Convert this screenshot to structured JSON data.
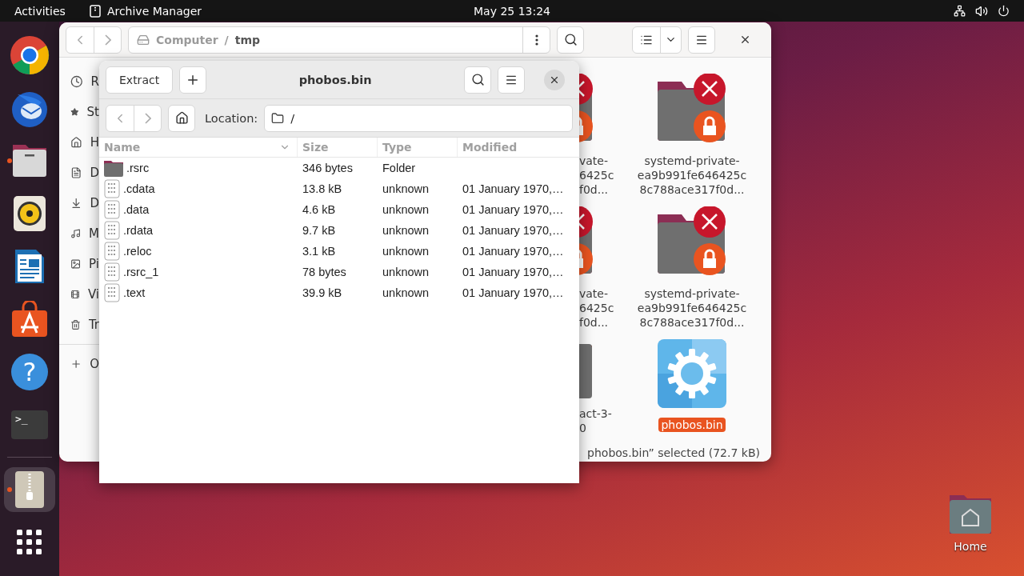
{
  "top_bar": {
    "activities": "Activities",
    "app_name": "Archive Manager",
    "clock": "May 25  13:24"
  },
  "dock": {
    "items": [
      {
        "kind": "chrome",
        "running": false,
        "selected": false
      },
      {
        "kind": "thunderbird",
        "running": false,
        "selected": false
      },
      {
        "kind": "files",
        "running": true,
        "selected": false
      },
      {
        "kind": "rhythmbox",
        "running": false,
        "selected": false
      },
      {
        "kind": "writer",
        "running": false,
        "selected": false
      },
      {
        "kind": "appstore",
        "running": false,
        "selected": false
      },
      {
        "kind": "help",
        "glyph": "?",
        "running": false,
        "selected": false
      },
      {
        "kind": "terminal",
        "glyph": ">_",
        "running": false,
        "selected": false
      },
      {
        "kind": "archive",
        "running": true,
        "selected": true
      },
      {
        "kind": "apps",
        "running": false,
        "selected": false
      }
    ]
  },
  "files_window": {
    "path": [
      "Computer",
      "tmp"
    ],
    "path_separator": "/",
    "sidebar": [
      {
        "kind": "recent",
        "label": "R"
      },
      {
        "kind": "starred",
        "label": "St"
      },
      {
        "kind": "home",
        "label": "H"
      },
      {
        "kind": "documents",
        "label": "D"
      },
      {
        "kind": "downloads",
        "label": "D"
      },
      {
        "kind": "music",
        "label": "M"
      },
      {
        "kind": "pictures",
        "label": "Pi"
      },
      {
        "kind": "videos",
        "label": "Vi"
      },
      {
        "kind": "trash",
        "label": "Tr"
      },
      {
        "kind": "other",
        "label": "O"
      }
    ],
    "clipped_items": [
      {
        "kind": "locked-folder",
        "lines": [
          "vate-",
          "6425c",
          "f0d..."
        ]
      },
      {
        "kind": "locked-folder",
        "lines": [
          "vate-",
          "6425c",
          "f0d..."
        ]
      },
      {
        "kind": "folder",
        "lines": [
          "act-3-",
          "0"
        ]
      }
    ],
    "items": [
      {
        "kind": "locked-folder",
        "lines": [
          "systemd-private-",
          "ea9b991fe646425c",
          "8c788ace317f0d..."
        ],
        "selected": false
      },
      {
        "kind": "locked-folder",
        "lines": [
          "systemd-private-",
          "ea9b991fe646425c",
          "8c788ace317f0d..."
        ],
        "selected": false
      },
      {
        "kind": "executable",
        "lines": [
          "phobos.bin"
        ],
        "selected": true
      }
    ],
    "status": "phobos.bin” selected (72.7 kB)"
  },
  "archive_window": {
    "title": "phobos.bin",
    "extract_button": "Extract",
    "location_label": "Location:",
    "location": "/",
    "columns": [
      "Name",
      "Size",
      "Type",
      "Modified"
    ],
    "rows": [
      {
        "kind": "folder",
        "name": ".rsrc",
        "size": "346 bytes",
        "type": "Folder"
      },
      {
        "kind": "binary",
        "name": ".cdata",
        "size": "13.8 kB",
        "type": "unknown",
        "modified": "01 January 1970,…"
      },
      {
        "kind": "binary",
        "name": ".data",
        "size": "4.6 kB",
        "type": "unknown",
        "modified": "01 January 1970,…"
      },
      {
        "kind": "binary",
        "name": ".rdata",
        "size": "9.7 kB",
        "type": "unknown",
        "modified": "01 January 1970,…"
      },
      {
        "kind": "binary",
        "name": ".reloc",
        "size": "3.1 kB",
        "type": "unknown",
        "modified": "01 January 1970,…"
      },
      {
        "kind": "binary",
        "name": ".rsrc_1",
        "size": "78 bytes",
        "type": "unknown",
        "modified": "01 January 1970,…"
      },
      {
        "kind": "binary",
        "name": ".text",
        "size": "39.9 kB",
        "type": "unknown",
        "modified": "01 January 1970,…"
      }
    ]
  },
  "desktop": {
    "icons": [
      {
        "label": "Home"
      }
    ]
  }
}
